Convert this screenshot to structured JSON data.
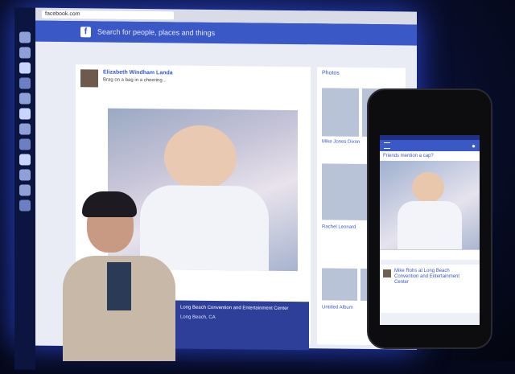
{
  "browser": {
    "url": "facebook.com"
  },
  "facebook": {
    "search_placeholder": "Search for people, places and things"
  },
  "post": {
    "author": "Elizabeth Windham Landa",
    "text": "Brag on a bag in a cheering..."
  },
  "event": {
    "title": "Long Beach Convention and Entertainment Center",
    "location": "Long Beach, CA"
  },
  "sidebar": {
    "title": "Photos",
    "names": [
      "Mike Jones Dixon",
      "Rachel Leonard"
    ],
    "card_title": "Untitled Album"
  },
  "phone": {
    "caption": "Friends mention a cap?",
    "post_text": "Mike Rohs at Long Beach Convention and Entertainment Center"
  }
}
